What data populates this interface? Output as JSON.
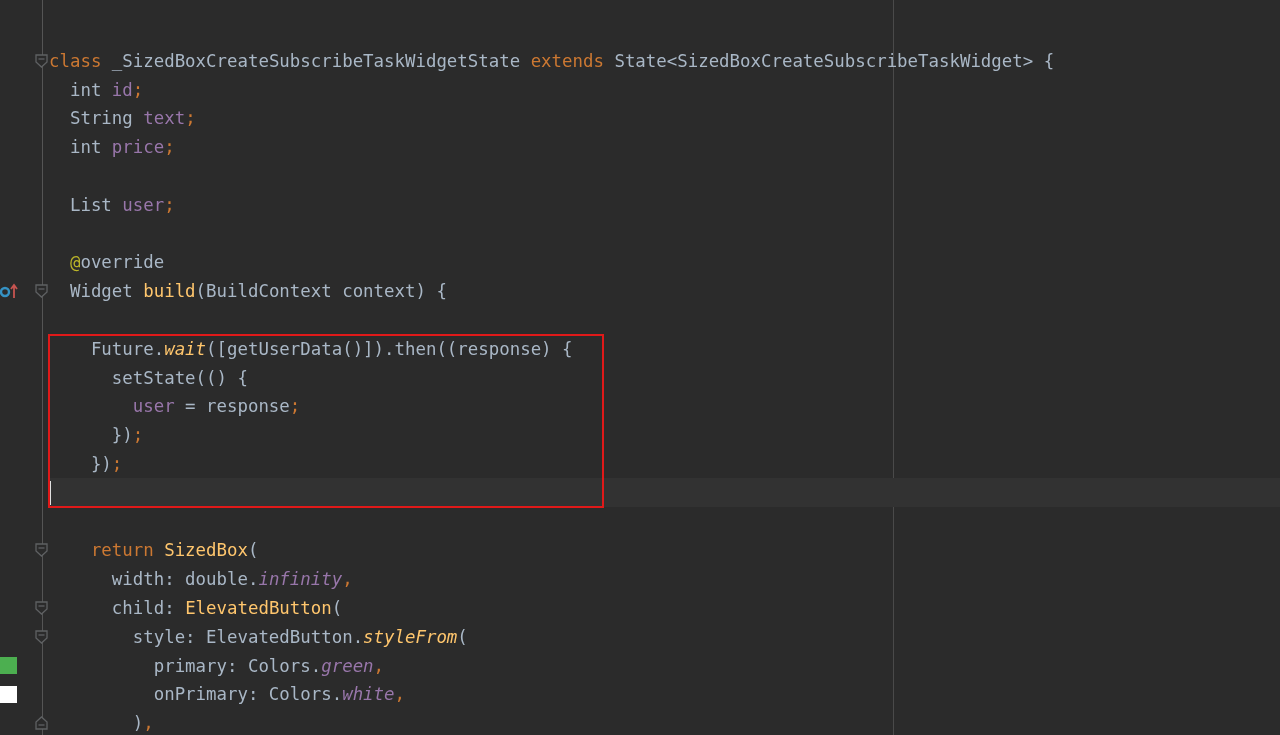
{
  "editor": {
    "lines": [
      {
        "current": false,
        "kind": "plain"
      },
      {
        "current": false,
        "kind": "fold_start",
        "tokens": [
          {
            "text": "class",
            "kind": "kw"
          },
          {
            "text": " _SizedBoxCreateSubscribeTaskWidgetState ",
            "kind": "plain"
          },
          {
            "text": "extends",
            "kind": "kw"
          },
          {
            "text": " State<SizedBoxCreateSubscribeTaskWidget> {",
            "kind": "plain"
          }
        ]
      },
      {
        "current": false,
        "kind": "plain",
        "tokens": [
          {
            "text": "  int ",
            "kind": "plain"
          },
          {
            "text": "id",
            "kind": "field"
          },
          {
            "text": ";",
            "kind": "punct"
          }
        ]
      },
      {
        "current": false,
        "kind": "plain",
        "tokens": [
          {
            "text": "  String ",
            "kind": "plain"
          },
          {
            "text": "text",
            "kind": "field"
          },
          {
            "text": ";",
            "kind": "punct"
          }
        ]
      },
      {
        "current": false,
        "kind": "plain",
        "tokens": [
          {
            "text": "  int ",
            "kind": "plain"
          },
          {
            "text": "price",
            "kind": "field"
          },
          {
            "text": ";",
            "kind": "punct"
          }
        ]
      },
      {
        "current": false,
        "kind": "plain"
      },
      {
        "current": false,
        "kind": "plain",
        "tokens": [
          {
            "text": "  List ",
            "kind": "plain"
          },
          {
            "text": "user",
            "kind": "field"
          },
          {
            "text": ";",
            "kind": "punct"
          }
        ]
      },
      {
        "current": false,
        "kind": "plain"
      },
      {
        "current": false,
        "kind": "plain",
        "tokens": [
          {
            "text": "  @",
            "kind": "annot"
          },
          {
            "text": "override",
            "kind": "plain"
          }
        ]
      },
      {
        "current": false,
        "kind": "fold_start",
        "mark": {
          "kind": "override"
        },
        "tokens": [
          {
            "text": "  Widget ",
            "kind": "plain"
          },
          {
            "text": "build",
            "kind": "func"
          },
          {
            "text": "(BuildContext context) {",
            "kind": "plain"
          }
        ]
      },
      {
        "current": false,
        "kind": "plain"
      },
      {
        "current": false,
        "kind": "plain",
        "tokens": [
          {
            "text": "    Future.",
            "kind": "plain"
          },
          {
            "text": "wait",
            "kind": "call"
          },
          {
            "text": "([getUserData()]).then((response) {",
            "kind": "plain"
          }
        ]
      },
      {
        "current": false,
        "kind": "plain",
        "tokens": [
          {
            "text": "      setState(() {",
            "kind": "plain"
          }
        ]
      },
      {
        "current": false,
        "kind": "plain",
        "tokens": [
          {
            "text": "        user",
            "kind": "field"
          },
          {
            "text": " = response",
            "kind": "plain"
          },
          {
            "text": ";",
            "kind": "punct"
          }
        ]
      },
      {
        "current": false,
        "kind": "plain",
        "tokens": [
          {
            "text": "      })",
            "kind": "plain"
          },
          {
            "text": ";",
            "kind": "punct"
          }
        ]
      },
      {
        "current": false,
        "kind": "plain",
        "tokens": [
          {
            "text": "    })",
            "kind": "plain"
          },
          {
            "text": ";",
            "kind": "punct"
          }
        ]
      },
      {
        "current": true,
        "kind": "plain"
      },
      {
        "current": false,
        "kind": "plain"
      },
      {
        "current": false,
        "kind": "fold_start",
        "tokens": [
          {
            "text": "    return ",
            "kind": "kw"
          },
          {
            "text": "SizedBox",
            "kind": "func"
          },
          {
            "text": "(",
            "kind": "plain"
          }
        ]
      },
      {
        "current": false,
        "kind": "plain",
        "tokens": [
          {
            "text": "      width: double.",
            "kind": "plain"
          },
          {
            "text": "infinity",
            "kind": "static"
          },
          {
            "text": ",",
            "kind": "punct"
          }
        ]
      },
      {
        "current": false,
        "kind": "fold_start",
        "tokens": [
          {
            "text": "      child: ",
            "kind": "plain"
          },
          {
            "text": "ElevatedButton",
            "kind": "func"
          },
          {
            "text": "(",
            "kind": "plain"
          }
        ]
      },
      {
        "current": false,
        "kind": "fold_start",
        "tokens": [
          {
            "text": "        style: ElevatedButton.",
            "kind": "plain"
          },
          {
            "text": "styleFrom",
            "kind": "call"
          },
          {
            "text": "(",
            "kind": "plain"
          }
        ]
      },
      {
        "current": false,
        "kind": "plain",
        "mark": {
          "kind": "swatch",
          "color": "#4caf50"
        },
        "tokens": [
          {
            "text": "          primary: Colors.",
            "kind": "plain"
          },
          {
            "text": "green",
            "kind": "static"
          },
          {
            "text": ",",
            "kind": "punct"
          }
        ]
      },
      {
        "current": false,
        "kind": "plain",
        "mark": {
          "kind": "swatch",
          "color": "#ffffff"
        },
        "tokens": [
          {
            "text": "          onPrimary: Colors.",
            "kind": "plain"
          },
          {
            "text": "white",
            "kind": "static"
          },
          {
            "text": ",",
            "kind": "punct"
          }
        ]
      },
      {
        "current": false,
        "kind": "fold_end",
        "tokens": [
          {
            "text": "        )",
            "kind": "plain"
          },
          {
            "text": ",",
            "kind": "punct"
          }
        ]
      }
    ]
  }
}
